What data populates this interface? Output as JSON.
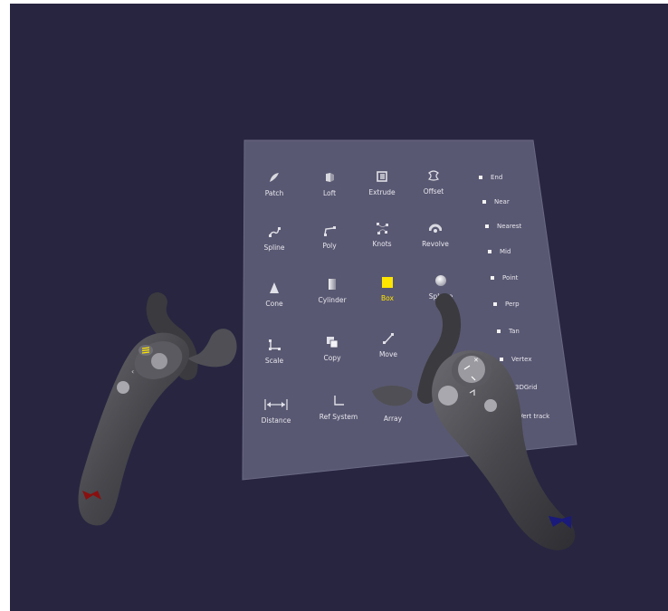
{
  "scene": {
    "background_color": "#272540",
    "panel_color": "#595872"
  },
  "tools": [
    {
      "label": "Patch",
      "icon": "patch-icon"
    },
    {
      "label": "Loft",
      "icon": "loft-icon"
    },
    {
      "label": "Extrude",
      "icon": "extrude-icon"
    },
    {
      "label": "Offset",
      "icon": "offset-icon"
    },
    {
      "label": "Spline",
      "icon": "spline-icon"
    },
    {
      "label": "Poly",
      "icon": "poly-icon"
    },
    {
      "label": "Knots",
      "icon": "knots-icon"
    },
    {
      "label": "Revolve",
      "icon": "revolve-icon"
    },
    {
      "label": "Cone",
      "icon": "cone-icon"
    },
    {
      "label": "Cylinder",
      "icon": "cylinder-icon"
    },
    {
      "label": "Box",
      "icon": "box-icon",
      "active": true,
      "active_color": "#ffe600"
    },
    {
      "label": "Sphere",
      "icon": "sphere-icon"
    },
    {
      "label": "Scale",
      "icon": "scale-icon"
    },
    {
      "label": "Copy",
      "icon": "copy-icon"
    },
    {
      "label": "Move",
      "icon": "move-icon"
    },
    {
      "label": "Distance",
      "icon": "distance-icon"
    },
    {
      "label": "Ref System",
      "icon": "ref-system-icon"
    },
    {
      "label": "Array",
      "icon": "array-icon"
    }
  ],
  "snaps": [
    {
      "label": "End"
    },
    {
      "label": "Near"
    },
    {
      "label": "Nearest"
    },
    {
      "label": "Mid"
    },
    {
      "label": "Point"
    },
    {
      "label": "Perp"
    },
    {
      "label": "Tan"
    },
    {
      "label": "Vertex"
    },
    {
      "label": "3DGrid"
    },
    {
      "label": "Vert track"
    }
  ],
  "controllers": {
    "left": {
      "body_color": "#4a4a4e",
      "logo_color": "#8a1010",
      "menu_glyph_color": "#ffe600"
    },
    "right": {
      "body_color": "#4a4a4e",
      "logo_color": "#1a1a7a"
    }
  }
}
